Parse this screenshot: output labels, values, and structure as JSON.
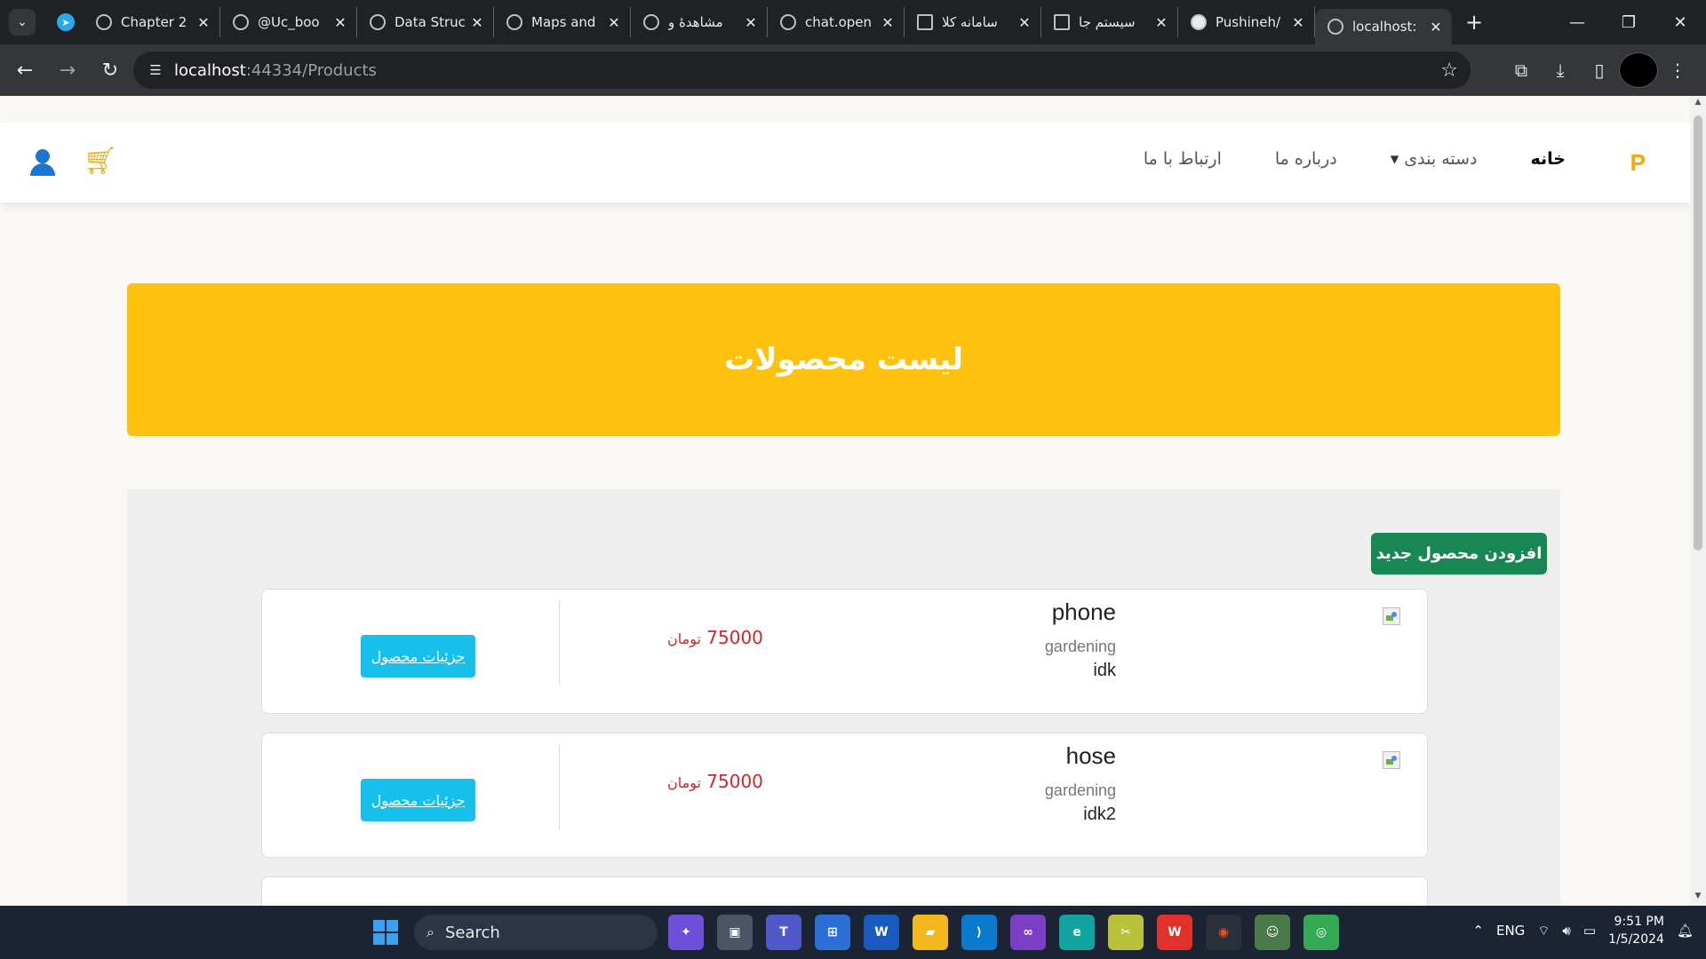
{
  "browser": {
    "tabs": [
      {
        "title": "Chapter 2"
      },
      {
        "title": "@Uc_boo"
      },
      {
        "title": "Data Struc"
      },
      {
        "title": "Maps and"
      },
      {
        "title": "مشاهدهٔ و"
      },
      {
        "title": "chat.open"
      },
      {
        "title": "سامانه کلا"
      },
      {
        "title": "سیستم جا"
      },
      {
        "title": "Pushineh/"
      },
      {
        "title": "localhost:"
      }
    ],
    "url_host": "localhost",
    "url_rest": ":44334/Products"
  },
  "navbar": {
    "logo": "P",
    "items": {
      "home": "خانه",
      "category": "دسته بندی",
      "about": "درباره ما",
      "contact": "ارتباط با ما"
    },
    "accent": "#f6a800"
  },
  "banner": {
    "title": "لیست محصولات",
    "color": "#fdc10e"
  },
  "actions": {
    "add_product": "افزودن محصول جدید"
  },
  "products": [
    {
      "name": "phone",
      "category": "gardening",
      "description": "idk",
      "price": "75000",
      "currency": "تومان",
      "details_label": "جزئیات محصول"
    },
    {
      "name": "hose",
      "category": "gardening",
      "description": "idk2",
      "price": "75000",
      "currency": "تومان",
      "details_label": "جزئیات محصول"
    }
  ],
  "taskbar": {
    "search_placeholder": "Search",
    "language": "ENG",
    "time": "9:51 PM",
    "date": "1/5/2024"
  }
}
